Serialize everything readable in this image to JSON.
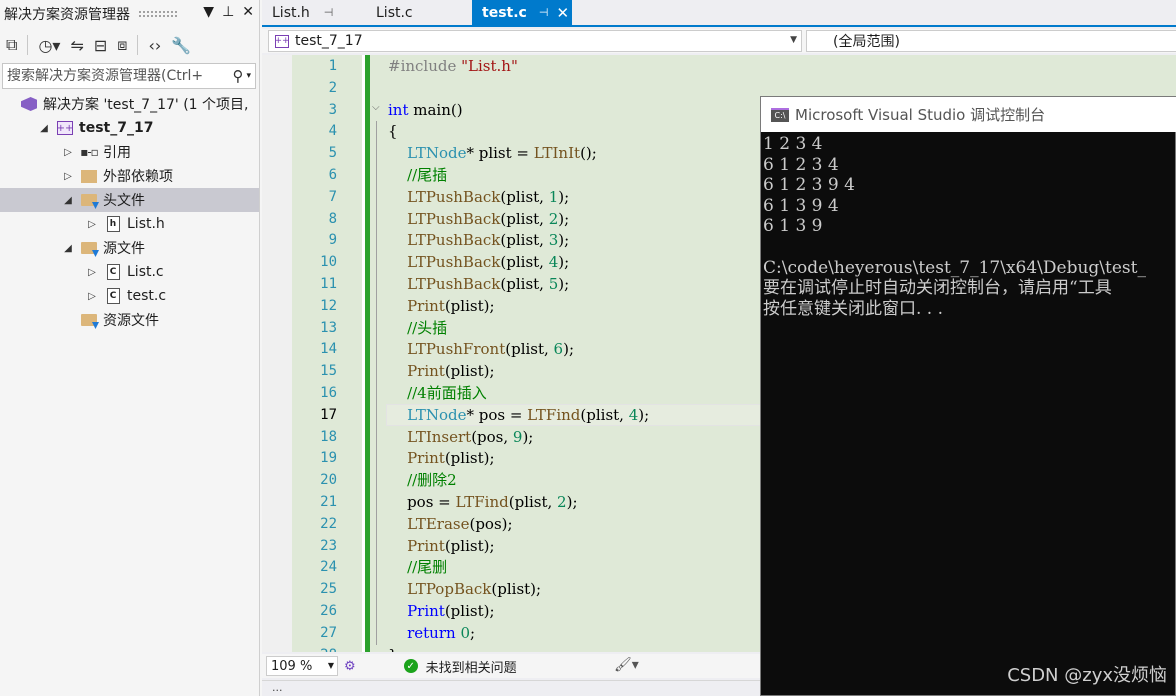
{
  "solution_explorer": {
    "title": "解决方案资源管理器",
    "search_placeholder": "搜索解决方案资源管理器(Ctrl+",
    "tree": [
      {
        "label": "解决方案 'test_7_17' (1 个项目,",
        "indent": 0,
        "arrow": "",
        "icon": "solution-icon"
      },
      {
        "label": "test_7_17",
        "indent": 1,
        "arrow": "◢",
        "icon": "project-icon",
        "bold": true
      },
      {
        "label": "引用",
        "indent": 2,
        "arrow": "▷",
        "icon": "reference-icon"
      },
      {
        "label": "外部依赖项",
        "indent": 2,
        "arrow": "▷",
        "icon": "external-deps-icon"
      },
      {
        "label": "头文件",
        "indent": 2,
        "arrow": "◢",
        "icon": "folder-icon",
        "selected": true
      },
      {
        "label": "List.h",
        "indent": 3,
        "arrow": "▷",
        "icon": "header-file-icon"
      },
      {
        "label": "源文件",
        "indent": 2,
        "arrow": "◢",
        "icon": "folder-icon"
      },
      {
        "label": "List.c",
        "indent": 3,
        "arrow": "▷",
        "icon": "c-file-icon"
      },
      {
        "label": "test.c",
        "indent": 3,
        "arrow": "▷",
        "icon": "c-file-icon"
      },
      {
        "label": "资源文件",
        "indent": 2,
        "arrow": "",
        "icon": "folder-icon"
      }
    ]
  },
  "tabs": [
    {
      "label": "List.h",
      "active": false
    },
    {
      "label": "List.c",
      "active": false
    },
    {
      "label": "test.c",
      "active": true
    }
  ],
  "navbar": {
    "project": "test_7_17",
    "scope": "(全局范围)"
  },
  "code": {
    "current_line": 17,
    "lines": [
      [
        {
          "t": "#include ",
          "c": "pp"
        },
        {
          "t": "\"List.h\"",
          "c": "st"
        }
      ],
      [],
      [
        {
          "t": "int",
          "c": "kw"
        },
        {
          "t": " main()"
        }
      ],
      [
        {
          "t": "{"
        }
      ],
      [
        {
          "t": "    "
        },
        {
          "t": "LTNode",
          "c": "ty"
        },
        {
          "t": "* plist = "
        },
        {
          "t": "LTInIt",
          "c": "fn"
        },
        {
          "t": "();"
        }
      ],
      [
        {
          "t": "    "
        },
        {
          "t": "//尾插",
          "c": "cm"
        }
      ],
      [
        {
          "t": "    "
        },
        {
          "t": "LTPushBack",
          "c": "fn"
        },
        {
          "t": "(plist, "
        },
        {
          "t": "1",
          "c": "nm"
        },
        {
          "t": ");"
        }
      ],
      [
        {
          "t": "    "
        },
        {
          "t": "LTPushBack",
          "c": "fn"
        },
        {
          "t": "(plist, "
        },
        {
          "t": "2",
          "c": "nm"
        },
        {
          "t": ");"
        }
      ],
      [
        {
          "t": "    "
        },
        {
          "t": "LTPushBack",
          "c": "fn"
        },
        {
          "t": "(plist, "
        },
        {
          "t": "3",
          "c": "nm"
        },
        {
          "t": ");"
        }
      ],
      [
        {
          "t": "    "
        },
        {
          "t": "LTPushBack",
          "c": "fn"
        },
        {
          "t": "(plist, "
        },
        {
          "t": "4",
          "c": "nm"
        },
        {
          "t": ");"
        }
      ],
      [
        {
          "t": "    "
        },
        {
          "t": "LTPushBack",
          "c": "fn"
        },
        {
          "t": "(plist, "
        },
        {
          "t": "5",
          "c": "nm"
        },
        {
          "t": ");"
        }
      ],
      [
        {
          "t": "    "
        },
        {
          "t": "Print",
          "c": "fn"
        },
        {
          "t": "(plist);"
        }
      ],
      [
        {
          "t": "    "
        },
        {
          "t": "//头插",
          "c": "cm"
        }
      ],
      [
        {
          "t": "    "
        },
        {
          "t": "LTPushFront",
          "c": "fn"
        },
        {
          "t": "(plist, "
        },
        {
          "t": "6",
          "c": "nm"
        },
        {
          "t": ");"
        }
      ],
      [
        {
          "t": "    "
        },
        {
          "t": "Print",
          "c": "fn"
        },
        {
          "t": "(plist);"
        }
      ],
      [
        {
          "t": "    "
        },
        {
          "t": "//4前面插入",
          "c": "cm"
        }
      ],
      [
        {
          "t": "    "
        },
        {
          "t": "LTNode",
          "c": "ty"
        },
        {
          "t": "* pos = "
        },
        {
          "t": "LTFind",
          "c": "fn"
        },
        {
          "t": "(plist, "
        },
        {
          "t": "4",
          "c": "nm"
        },
        {
          "t": ");"
        }
      ],
      [
        {
          "t": "    "
        },
        {
          "t": "LTInsert",
          "c": "fn"
        },
        {
          "t": "(pos, "
        },
        {
          "t": "9",
          "c": "nm"
        },
        {
          "t": ");"
        }
      ],
      [
        {
          "t": "    "
        },
        {
          "t": "Print",
          "c": "fn"
        },
        {
          "t": "(plist);"
        }
      ],
      [
        {
          "t": "    "
        },
        {
          "t": "//删除2",
          "c": "cm"
        }
      ],
      [
        {
          "t": "    pos = "
        },
        {
          "t": "LTFind",
          "c": "fn"
        },
        {
          "t": "(plist, "
        },
        {
          "t": "2",
          "c": "nm"
        },
        {
          "t": ");"
        }
      ],
      [
        {
          "t": "    "
        },
        {
          "t": "LTErase",
          "c": "fn"
        },
        {
          "t": "(pos);"
        }
      ],
      [
        {
          "t": "    "
        },
        {
          "t": "Print",
          "c": "fn"
        },
        {
          "t": "(plist);"
        }
      ],
      [
        {
          "t": "    "
        },
        {
          "t": "//尾删",
          "c": "cm"
        }
      ],
      [
        {
          "t": "    "
        },
        {
          "t": "LTPopBack",
          "c": "fn"
        },
        {
          "t": "(plist);"
        }
      ],
      [
        {
          "t": "    "
        },
        {
          "t": "Print",
          "c": "kw"
        },
        {
          "t": "(plist);"
        }
      ],
      [
        {
          "t": "    "
        },
        {
          "t": "return",
          "c": "kw"
        },
        {
          "t": " "
        },
        {
          "t": "0",
          "c": "nm"
        },
        {
          "t": ";"
        }
      ],
      [
        {
          "t": "}"
        }
      ]
    ]
  },
  "status": {
    "zoom": "109 %",
    "issues": "未找到相关问题"
  },
  "bottom_strip": "...",
  "console": {
    "title": "Microsoft Visual Studio 调试控制台",
    "icon_text": "C:\\",
    "lines": [
      "1 2 3 4",
      "6 1 2 3 4",
      "6 1 2 3 9 4",
      "6 1 3 9 4",
      "6 1 3 9",
      "",
      "C:\\code\\heyerous\\test_7_17\\x64\\Debug\\test_",
      "要在调试停止时自动关闭控制台，请启用“工具",
      "按任意键关闭此窗口. . ."
    ]
  },
  "watermark": "CSDN @zyx没烦恼"
}
